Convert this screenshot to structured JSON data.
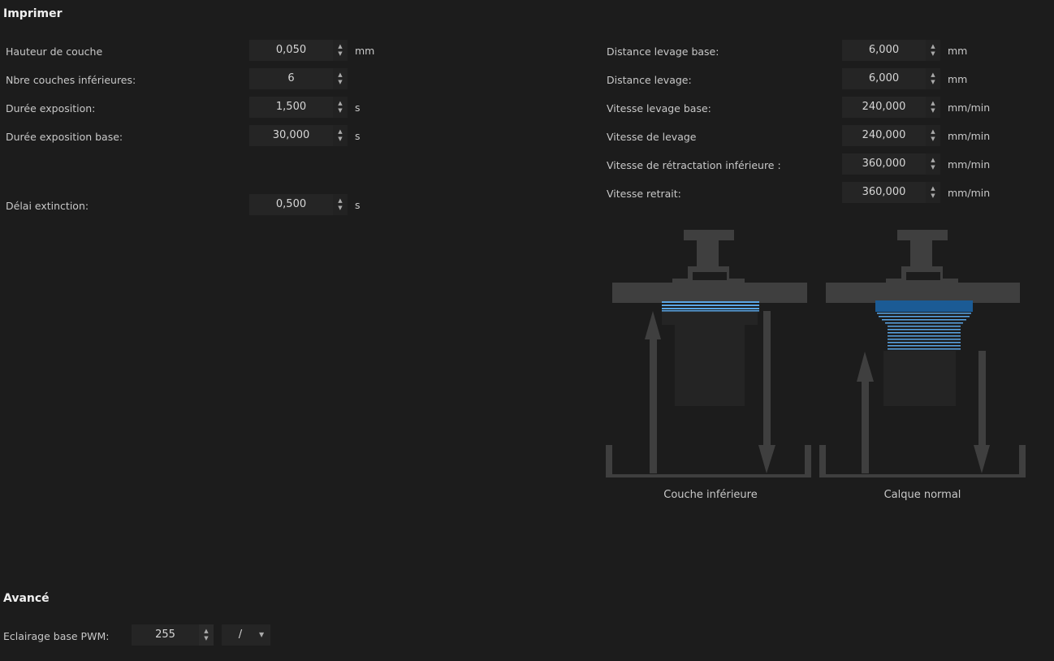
{
  "sections": {
    "print": "Imprimer",
    "advanced": "Avancé"
  },
  "left_fields": [
    {
      "label": "Hauteur de couche",
      "value": "0,050",
      "unit": "mm"
    },
    {
      "label": "Nbre couches inférieures:",
      "value": "6",
      "unit": ""
    },
    {
      "label": "Durée exposition:",
      "value": "1,500",
      "unit": "s"
    },
    {
      "label": "Durée exposition base:",
      "value": "30,000",
      "unit": "s"
    },
    {
      "label": "Délai extinction:",
      "value": "0,500",
      "unit": "s"
    }
  ],
  "right_fields": [
    {
      "label": "Distance levage base:",
      "value": "6,000",
      "unit": "mm"
    },
    {
      "label": "Distance levage:",
      "value": "6,000",
      "unit": "mm"
    },
    {
      "label": "Vitesse levage base:",
      "value": "240,000",
      "unit": "mm/min"
    },
    {
      "label": "Vitesse de levage",
      "value": "240,000",
      "unit": "mm/min"
    },
    {
      "label": "Vitesse de rétractation inférieure :",
      "value": "360,000",
      "unit": "mm/min"
    },
    {
      "label": "Vitesse retrait:",
      "value": "360,000",
      "unit": "mm/min"
    }
  ],
  "diagram": {
    "left_caption": "Couche inférieure",
    "right_caption": "Calque normal",
    "layer_color": "#5aa6e6"
  },
  "advanced": {
    "pwm_label": "Eclairage base PWM:",
    "pwm_value": "255",
    "unit_select": "/"
  }
}
